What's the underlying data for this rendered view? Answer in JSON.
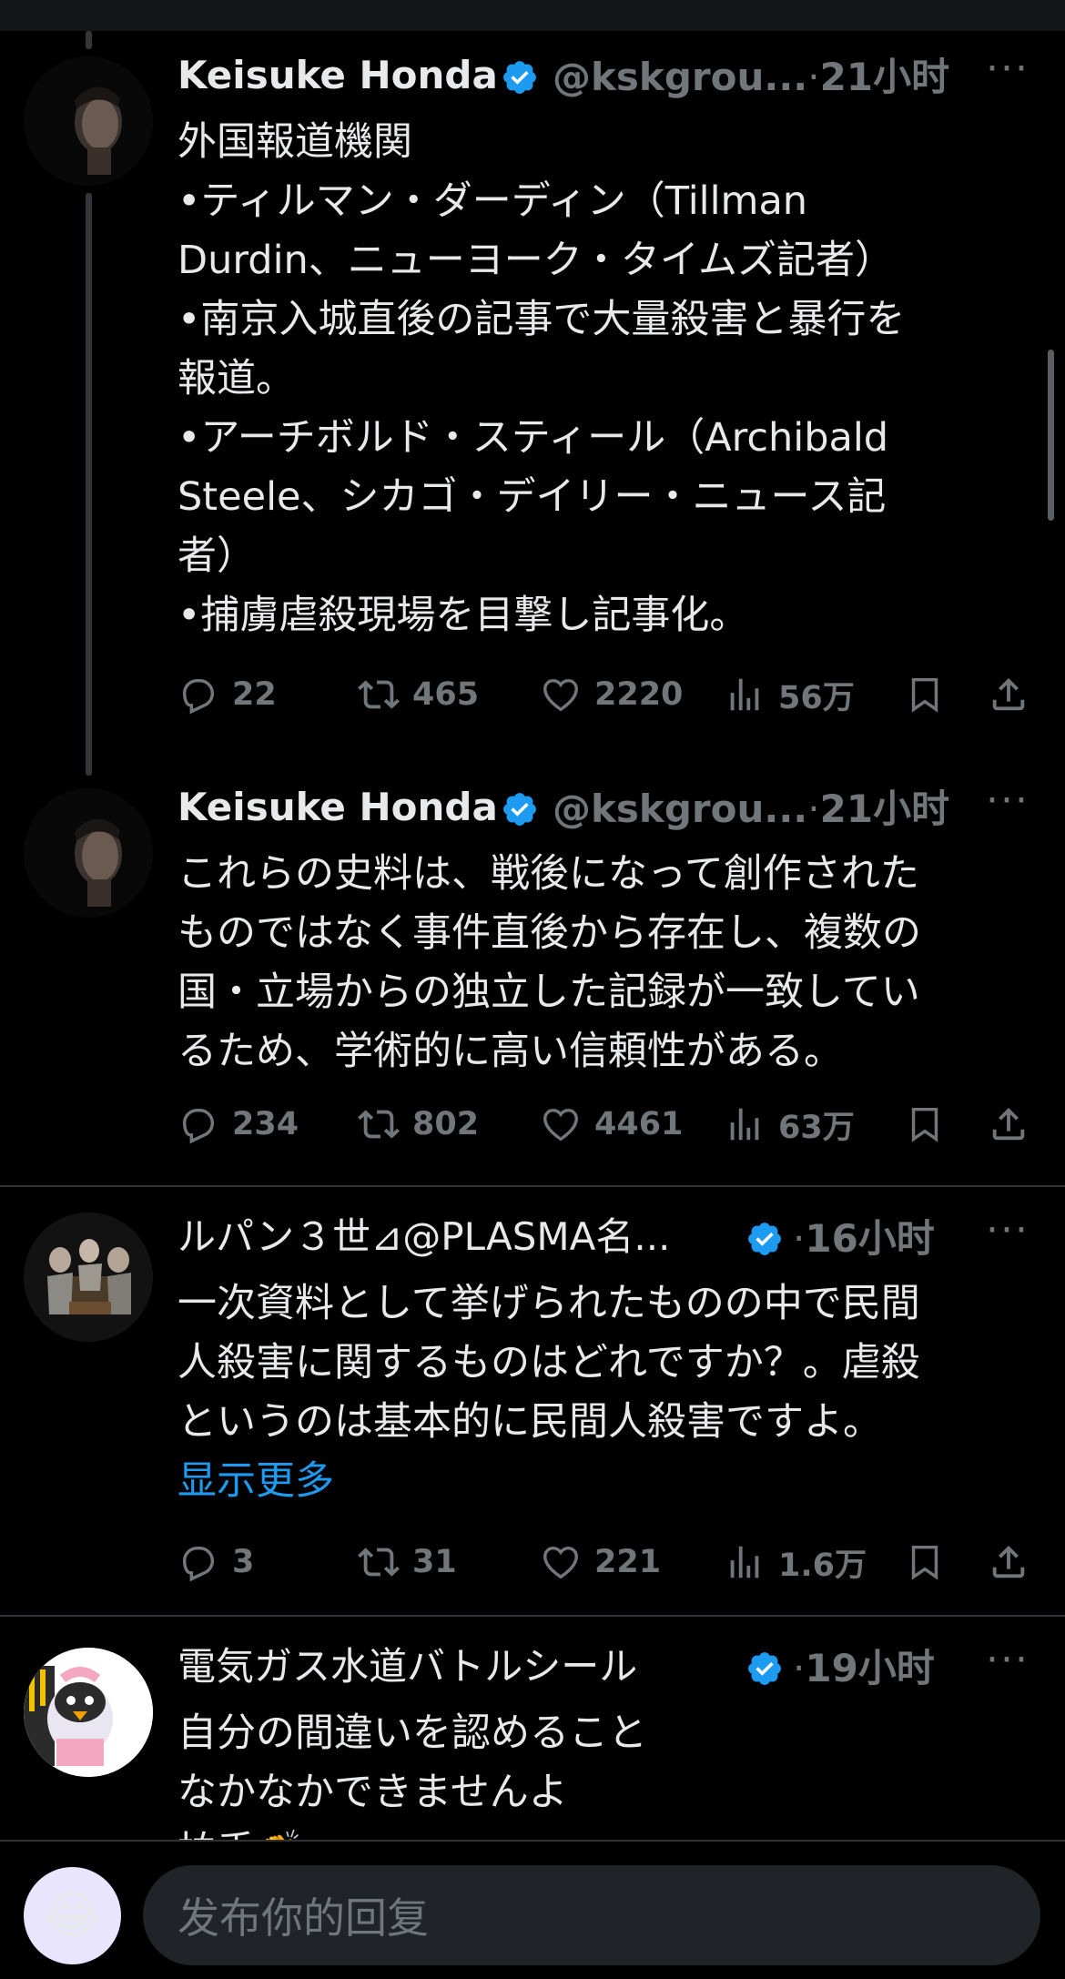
{
  "tweets": [
    {
      "name": "Keisuke Honda",
      "handle": "@kskgrou...",
      "sep": "·",
      "time": "21小时",
      "lines": [
        "外国報道機関",
        "•ティルマン・ダーディン（Tillman",
        "Durdin、ニューヨーク・タイムズ記者）",
        "•南京入城直後の記事で大量殺害と暴行を",
        "報道。",
        "•アーチボルド・スティール（Archibald",
        "Steele、シカゴ・デイリー・ニュース記",
        "者）",
        "•捕虜虐殺現場を目撃し記事化。"
      ],
      "replies": "22",
      "retweets": "465",
      "likes": "2220",
      "views": "56万"
    },
    {
      "name": "Keisuke Honda",
      "handle": "@kskgrou...",
      "sep": "·",
      "time": "21小时",
      "lines": [
        "これらの史料は、戦後になって創作された",
        "ものではなく事件直後から存在し、複数の",
        "国・立場からの独立した記録が一致してい",
        "るため、学術的に高い信頼性がある。"
      ],
      "replies": "234",
      "retweets": "802",
      "likes": "4461",
      "views": "63万"
    },
    {
      "name": "ルパン３世⊿@PLASMA名...",
      "sep": "·",
      "time": "16小时",
      "lines": [
        "一次資料として挙げられたものの中で民間",
        "人殺害に関するものはどれですか？。虐殺",
        "というのは基本的に民間人殺害ですよ。"
      ],
      "show_more": "显示更多",
      "replies": "3",
      "retweets": "31",
      "likes": "221",
      "views": "1.6万"
    },
    {
      "name": "電気ガス水道バトルシール",
      "sep": "·",
      "time": "19小时",
      "lines": [
        "自分の間違いを認めること",
        "なかなかできませんよ",
        "拍手👏"
      ]
    }
  ],
  "more_label": "···",
  "reply_bar": {
    "emoji": "😂",
    "placeholder": "发布你的回复"
  },
  "colors": {
    "background": "#000000",
    "text": "#e7e9ea",
    "muted": "#71767b",
    "link": "#1d9bf0",
    "verified": "#1d9bf0",
    "divider": "#2f3336"
  },
  "icons": [
    "reply-icon",
    "retweet-icon",
    "like-icon",
    "views-icon",
    "bookmark-icon",
    "share-icon",
    "verified-badge-icon",
    "more-icon"
  ]
}
